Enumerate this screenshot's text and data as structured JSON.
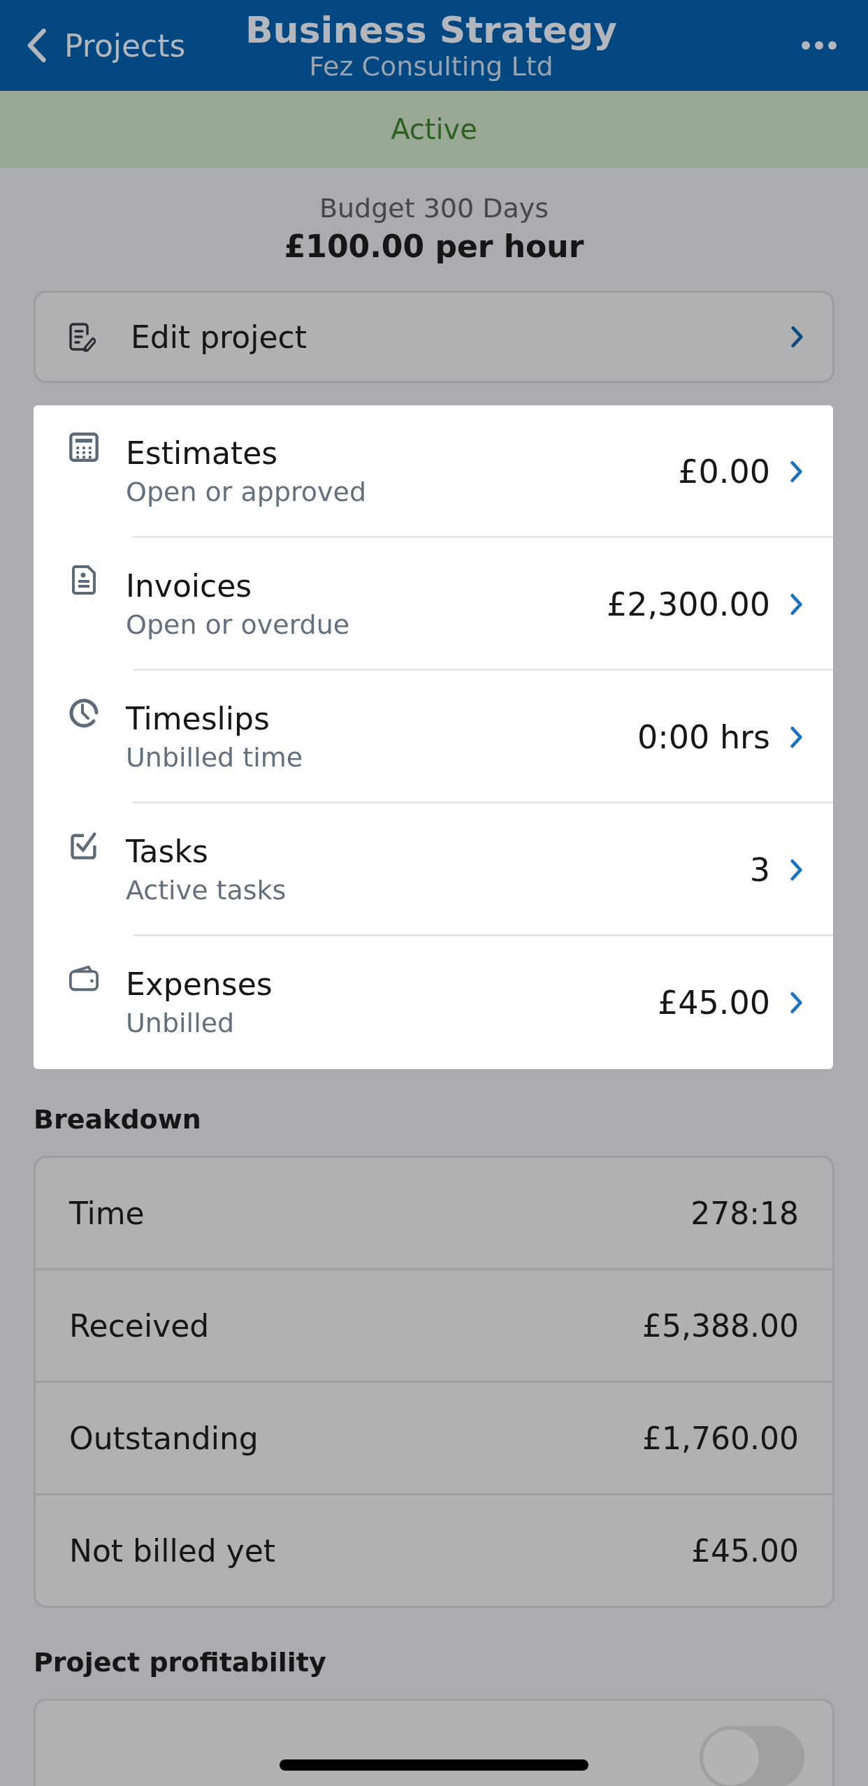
{
  "nav": {
    "back_label": "Projects",
    "title": "Business Strategy",
    "subtitle": "Fez Consulting Ltd"
  },
  "status": {
    "label": "Active"
  },
  "budget": {
    "line": "Budget 300 Days",
    "rate": "£100.00 per hour"
  },
  "edit_button": {
    "label": "Edit project"
  },
  "summary": [
    {
      "kind": "estimates",
      "title": "Estimates",
      "subtitle": "Open or approved",
      "value": "£0.00"
    },
    {
      "kind": "invoices",
      "title": "Invoices",
      "subtitle": "Open or overdue",
      "value": "£2,300.00"
    },
    {
      "kind": "timeslips",
      "title": "Timeslips",
      "subtitle": "Unbilled time",
      "value": "0:00 hrs"
    },
    {
      "kind": "tasks",
      "title": "Tasks",
      "subtitle": "Active tasks",
      "value": "3"
    },
    {
      "kind": "expenses",
      "title": "Expenses",
      "subtitle": "Unbilled",
      "value": "£45.00"
    }
  ],
  "breakdown": {
    "heading": "Breakdown",
    "rows": [
      {
        "label": "Time",
        "value": "278:18"
      },
      {
        "label": "Received",
        "value": "£5,388.00"
      },
      {
        "label": "Outstanding",
        "value": "£1,760.00"
      },
      {
        "label": "Not billed yet",
        "value": "£45.00"
      }
    ]
  },
  "profitability": {
    "heading": "Project profitability",
    "toggle": {
      "on": false
    }
  }
}
